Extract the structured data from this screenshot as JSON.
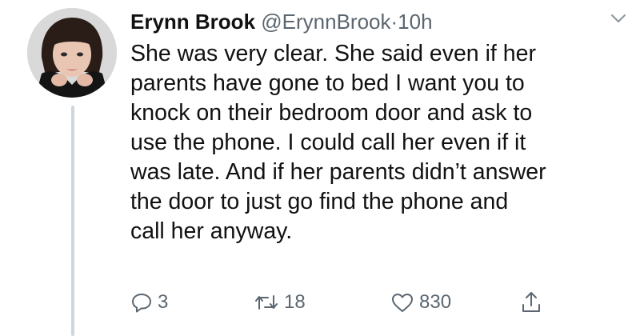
{
  "tweet": {
    "display_name": "Erynn Brook",
    "handle": "@ErynnBrook",
    "separator": "·",
    "time": "10h",
    "text_lines": [
      "She was very clear. She said even if her",
      "parents have gone to bed I want you to",
      "knock on their bedroom door and ask to",
      "use the phone. I could call her even if it",
      "was late. And if her parents didn’t answer",
      "the door to just go find the phone and",
      "call her anyway."
    ],
    "actions": {
      "reply_count": "3",
      "retweet_count": "18",
      "like_count": "830"
    },
    "icons": {
      "avatar": "profile-photo",
      "caret": "chevron-down-icon",
      "reply": "reply-icon",
      "retweet": "retweet-icon",
      "like": "heart-icon",
      "share": "share-icon"
    },
    "colors": {
      "text": "#111111",
      "muted": "#5b6670",
      "thread_line": "#cfd6dc"
    }
  }
}
